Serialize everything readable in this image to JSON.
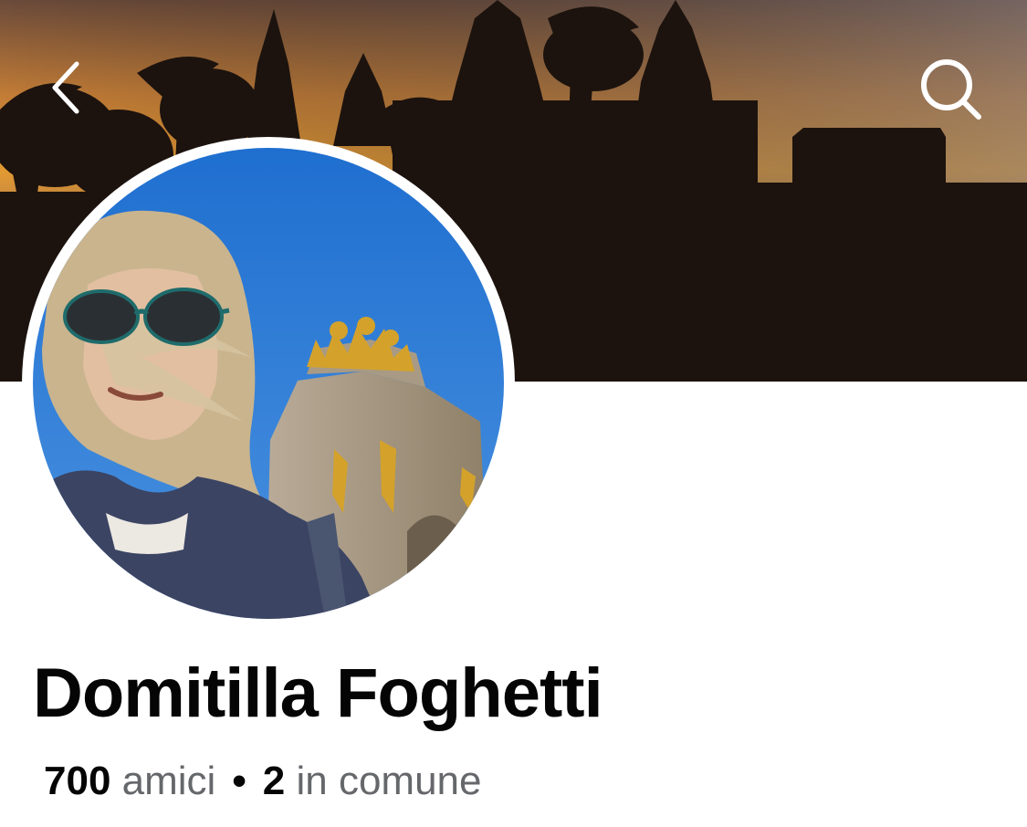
{
  "profile": {
    "name": "Domitilla Foghetti",
    "friends_count": "700",
    "friends_label": "amici",
    "separator": "•",
    "mutual_count": "2",
    "mutual_label": "in comune"
  },
  "icons": {
    "back": "chevron-left-icon",
    "search": "search-icon"
  },
  "colors": {
    "text_primary": "#050505",
    "text_secondary": "#65676b",
    "sky_blue": "#2f7fd6",
    "sunset_orange": "#e0942e"
  }
}
